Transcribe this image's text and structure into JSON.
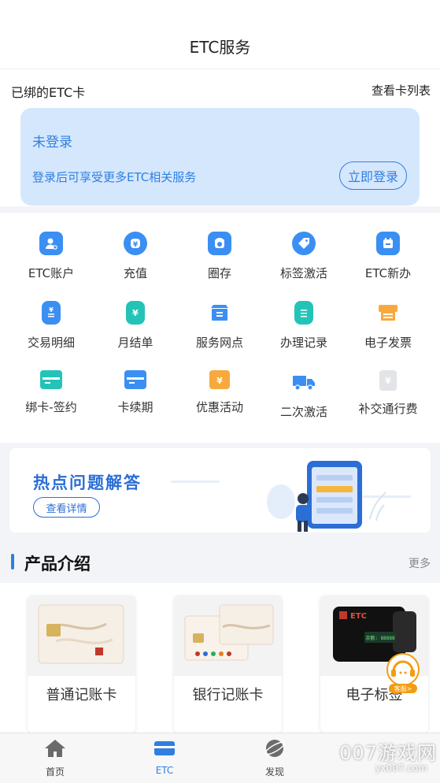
{
  "header": {
    "title": "ETC服务"
  },
  "card_section": {
    "bound_label": "已绑的ETC卡",
    "list_link": "查看卡列表",
    "login_card": {
      "state": "未登录",
      "hint": "登录后可享受更多ETC相关服务",
      "login_button": "立即登录"
    }
  },
  "menu": {
    "items": [
      {
        "label": "ETC账户",
        "icon": "account-icon",
        "color": "#3b8ff3"
      },
      {
        "label": "充值",
        "icon": "recharge-icon",
        "color": "#3b8ff3"
      },
      {
        "label": "圈存",
        "icon": "deposit-icon",
        "color": "#3b8ff3"
      },
      {
        "label": "标签激活",
        "icon": "tag-icon",
        "color": "#3b8ff3"
      },
      {
        "label": "ETC新办",
        "icon": "new-apply-icon",
        "color": "#3b8ff3"
      },
      {
        "label": "交易明细",
        "icon": "receipt-icon",
        "color": "#3b8ff3"
      },
      {
        "label": "月结单",
        "icon": "monthly-bill-icon",
        "color": "#24c3b8"
      },
      {
        "label": "服务网点",
        "icon": "store-icon",
        "color": "#3b8ff3"
      },
      {
        "label": "办理记录",
        "icon": "clipboard-icon",
        "color": "#24c3b8"
      },
      {
        "label": "电子发票",
        "icon": "invoice-icon",
        "color": "#f8a93d"
      },
      {
        "label": "绑卡-签约",
        "icon": "bind-card-icon",
        "color": "#24c3b8"
      },
      {
        "label": "卡续期",
        "icon": "card-renew-icon",
        "color": "#3b8ff3"
      },
      {
        "label": "优惠活动",
        "icon": "coupon-icon",
        "color": "#f8a93d"
      },
      {
        "label": "二次激活",
        "icon": "truck-icon",
        "color": "#3b8ff3"
      },
      {
        "label": "补交通行费",
        "icon": "toll-payment-icon",
        "color": "#d6d9de"
      }
    ]
  },
  "banner": {
    "title": "热点问题解答",
    "button": "查看详情"
  },
  "products": {
    "heading": "产品介绍",
    "more": "更多",
    "items": [
      {
        "name": "普通记账卡"
      },
      {
        "name": "银行记账卡"
      },
      {
        "name": "电子标签"
      }
    ],
    "etc_device_text": "ETC",
    "device_screen_text": "余额: 88888",
    "customer_service_label": "客服>"
  },
  "tabbar": {
    "tabs": [
      {
        "label": "首页",
        "icon": "home-icon"
      },
      {
        "label": "ETC",
        "icon": "etc-card-icon"
      },
      {
        "label": "发现",
        "icon": "discover-icon"
      }
    ],
    "active": "ETC"
  },
  "watermark": {
    "text": "007游戏网",
    "sub": "yx007.com"
  }
}
